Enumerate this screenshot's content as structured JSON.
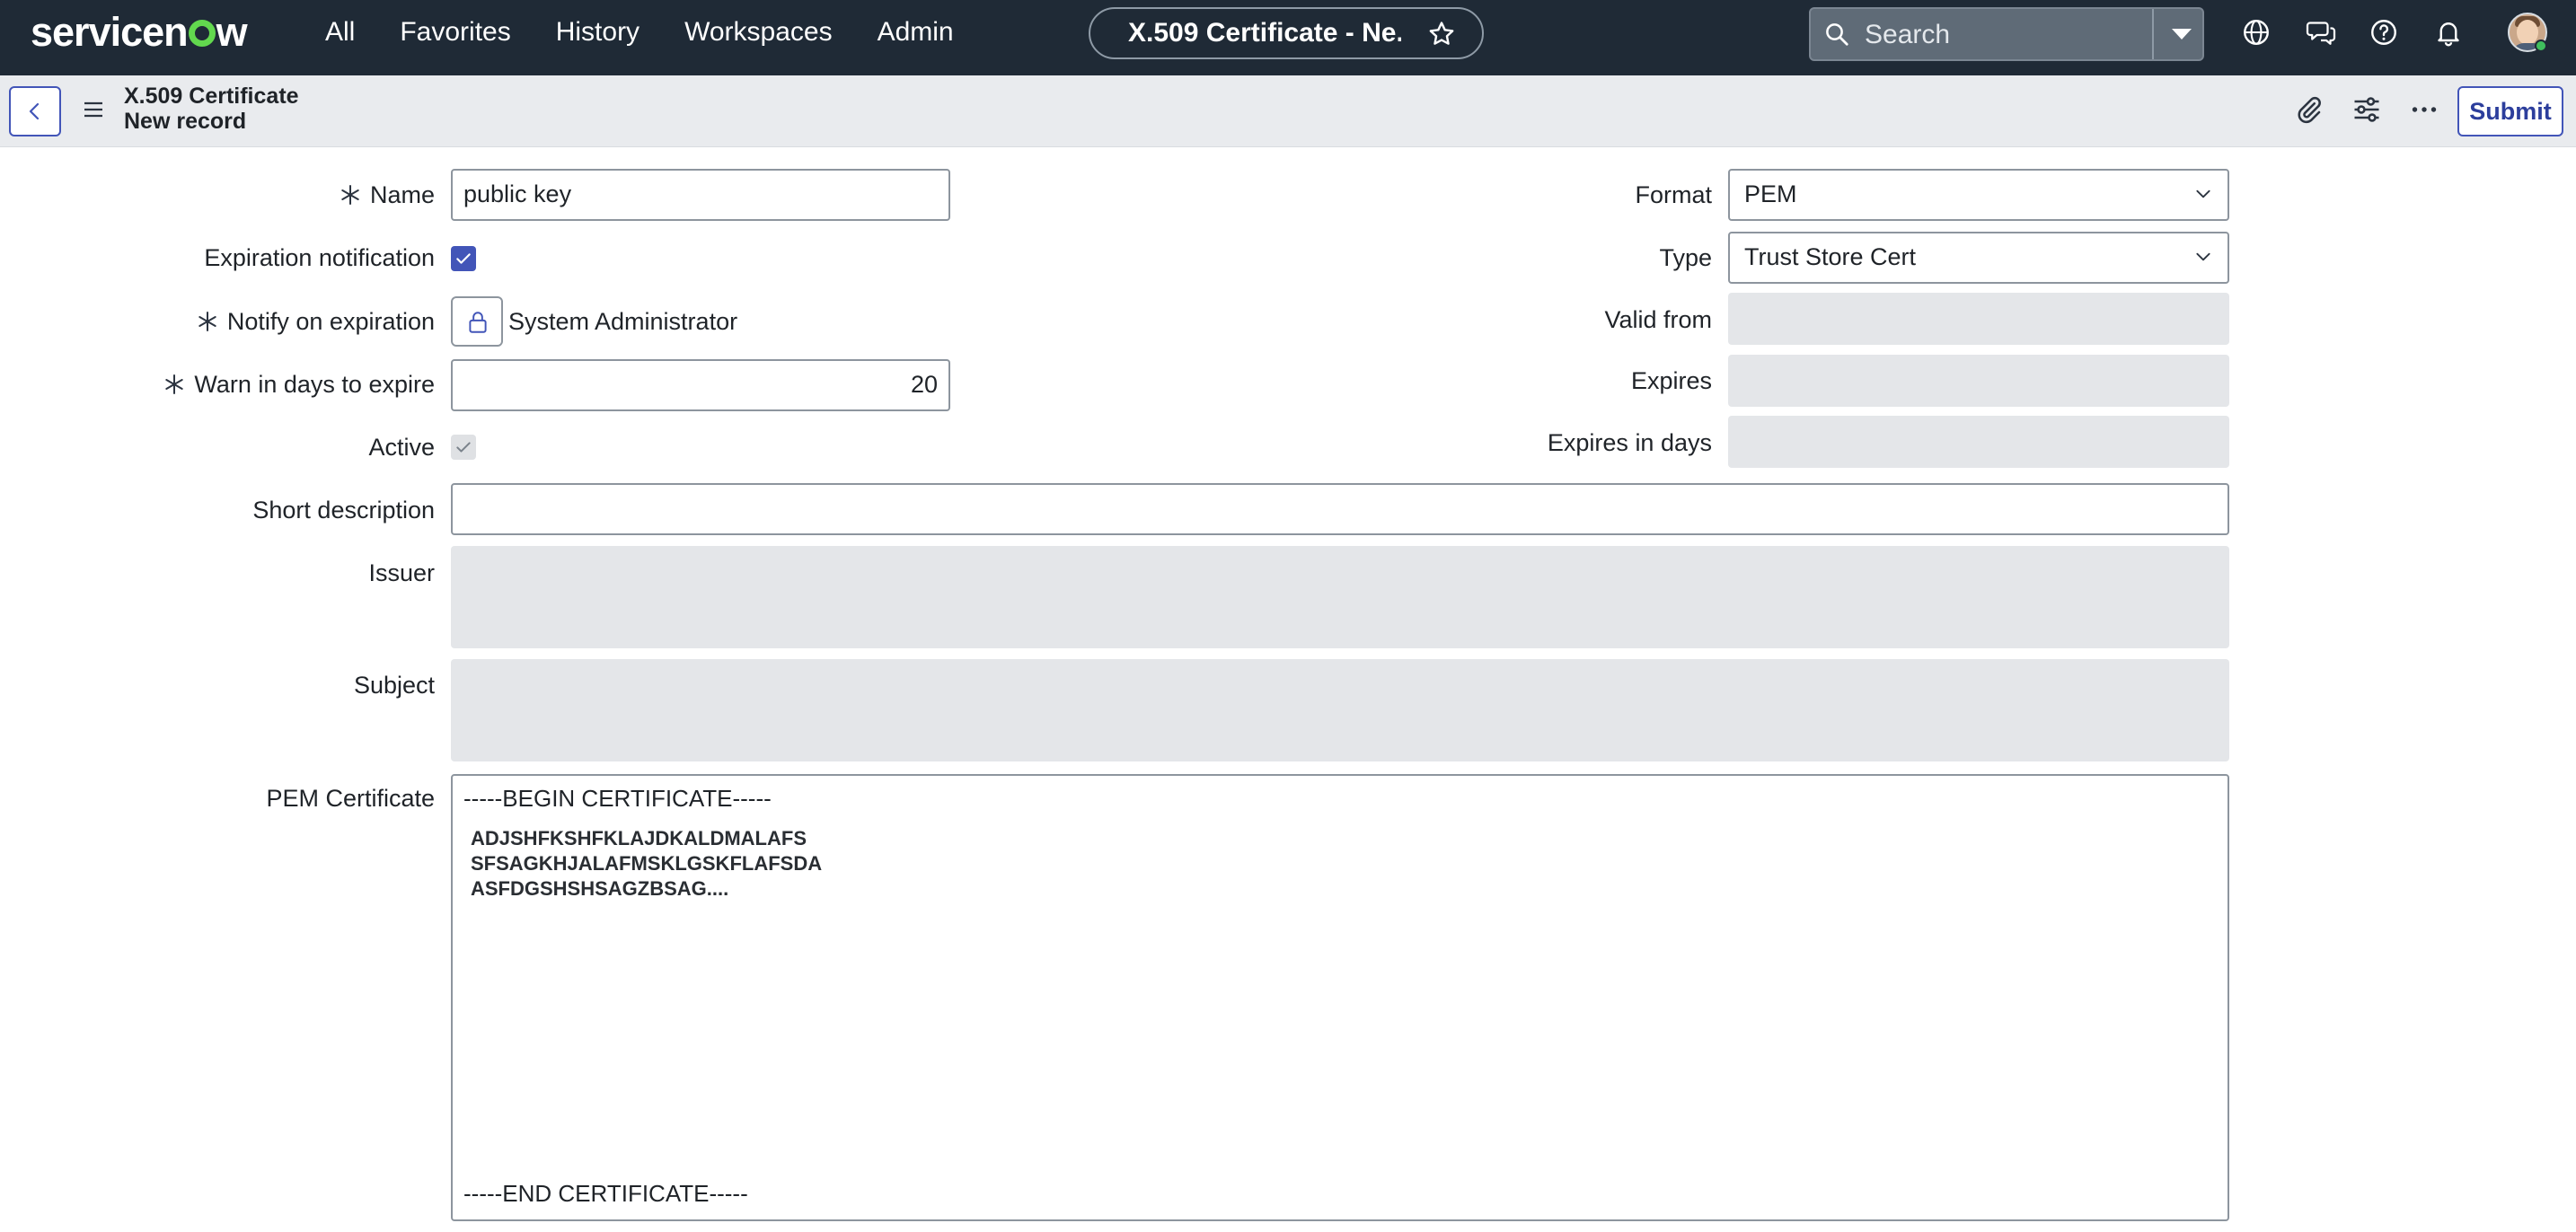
{
  "topnav": {
    "logo_pre": "servicen",
    "logo_post": "w",
    "menu": [
      "All",
      "Favorites",
      "History",
      "Workspaces",
      "Admin"
    ],
    "context_title": "X.509 Certificate - Ne...",
    "search_placeholder": "Search",
    "icons": [
      "globe-icon",
      "chat-icon",
      "help-icon",
      "bell-icon"
    ]
  },
  "record": {
    "title": "X.509 Certificate",
    "subtitle": "New record",
    "submit_label": "Submit"
  },
  "form": {
    "name_label": "Name",
    "name_value": "public key",
    "expiration_notification_label": "Expiration notification",
    "expiration_notification_checked": true,
    "notify_label": "Notify on expiration",
    "notify_value": "System Administrator",
    "warn_label": "Warn in days to expire",
    "warn_value": "20",
    "active_label": "Active",
    "active_checked": true,
    "short_description_label": "Short description",
    "short_description_value": "",
    "issuer_label": "Issuer",
    "subject_label": "Subject",
    "pem_label": "PEM Certificate",
    "pem_begin": "-----BEGIN CERTIFICATE-----",
    "pem_lines": [
      "ADJSHFKSHFKLAJDKALDMALAFS",
      "SFSAGKHJALAFMSKLGSKFLAFSDA",
      "ASFDGSHSHSAGZBSAG...."
    ],
    "pem_end": "-----END CERTIFICATE-----",
    "format_label": "Format",
    "format_value": "PEM",
    "type_label": "Type",
    "type_value": "Trust Store Cert",
    "valid_from_label": "Valid from",
    "expires_label": "Expires",
    "expires_in_days_label": "Expires in days"
  },
  "colors": {
    "nav_bg": "#1f2a36",
    "accent": "#4255b8",
    "logo_green": "#62d84e",
    "readonly_bg": "#e4e6e9"
  }
}
